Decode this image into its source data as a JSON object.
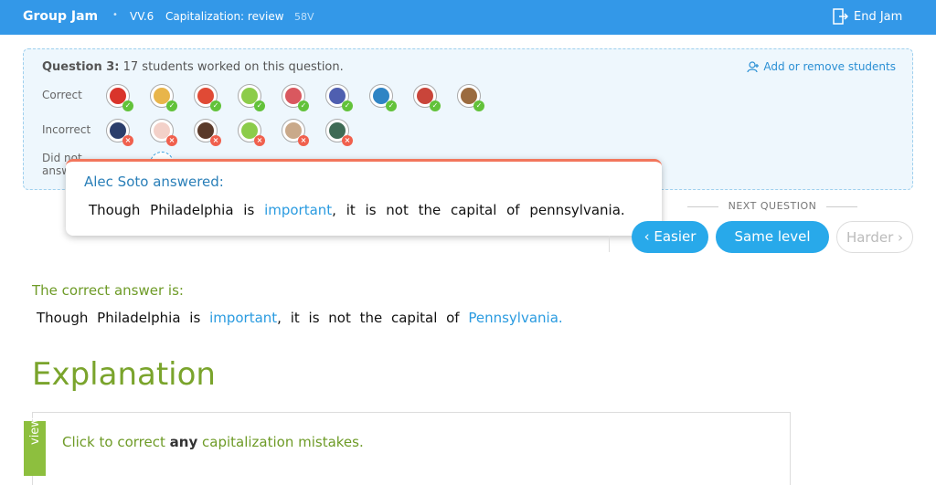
{
  "header": {
    "brand": "Group Jam",
    "skill_code": "VV.6",
    "skill_name": "Capitalization: review",
    "skill_id": "58V",
    "end_jam": "End Jam"
  },
  "question_panel": {
    "title_bold": "Question 3:",
    "title_rest": " 17 students worked on this question.",
    "add_remove": "Add or remove students",
    "rows": {
      "correct": "Correct",
      "incorrect": "Incorrect",
      "did_not_answer": "Did not answer"
    }
  },
  "popup": {
    "title": "Alec Soto answered:",
    "answer_pre": "Though Philadelphia is ",
    "answer_highlight": "important",
    "answer_post": ", it is not the capital of pennsylvania."
  },
  "next_question": {
    "label": "NEXT QUESTION",
    "easier": "Easier",
    "same": "Same level",
    "harder": "Harder"
  },
  "correct": {
    "label": "The correct answer is:",
    "pre": "Though Philadelphia is ",
    "highlight1": "important",
    "mid": ", it is not the capital of ",
    "highlight2": "Pennsylvania."
  },
  "explanation": {
    "heading": "Explanation",
    "tab": "view",
    "instruction_pre": "Click to correct ",
    "instruction_bold": "any",
    "instruction_post": " capitalization mistakes."
  },
  "colors": {
    "topbar": "#3398e8",
    "accent_blue": "#28a9ea",
    "correct_green": "#62c23a",
    "incorrect_red": "#f0604d",
    "explanation_green": "#7aa42c"
  }
}
